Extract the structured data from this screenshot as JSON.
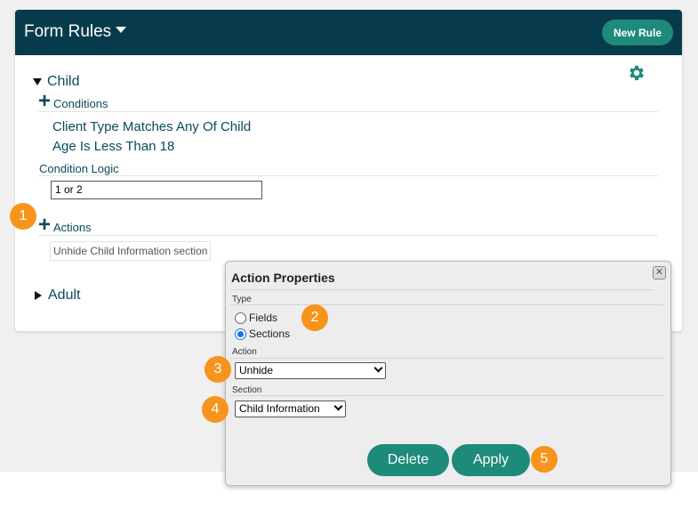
{
  "header": {
    "title": "Form Rules",
    "new_rule_label": "New Rule"
  },
  "rules": {
    "child": {
      "label": "Child",
      "conditions_label": "Conditions",
      "conditions": [
        "Client Type Matches Any Of Child",
        "Age Is Less Than 18"
      ],
      "condition_logic_label": "Condition Logic",
      "condition_logic_value": "1 or 2",
      "actions_label": "Actions",
      "actions": [
        "Unhide Child Information section"
      ]
    },
    "adult": {
      "label": "Adult"
    }
  },
  "dialog": {
    "title": "Action Properties",
    "close_icon": "close-icon",
    "type_label": "Type",
    "type_options": [
      "Fields",
      "Sections"
    ],
    "type_selected": "Sections",
    "action_label": "Action",
    "action_value": "Unhide",
    "section_label": "Section",
    "section_value": "Child Information",
    "delete_label": "Delete",
    "apply_label": "Apply"
  },
  "badges": [
    "1",
    "2",
    "3",
    "4",
    "5"
  ],
  "colors": {
    "header_bg": "#073b4c",
    "accent": "#1e8a7a",
    "badge": "#f7941d",
    "text": "#0b4a5c"
  }
}
